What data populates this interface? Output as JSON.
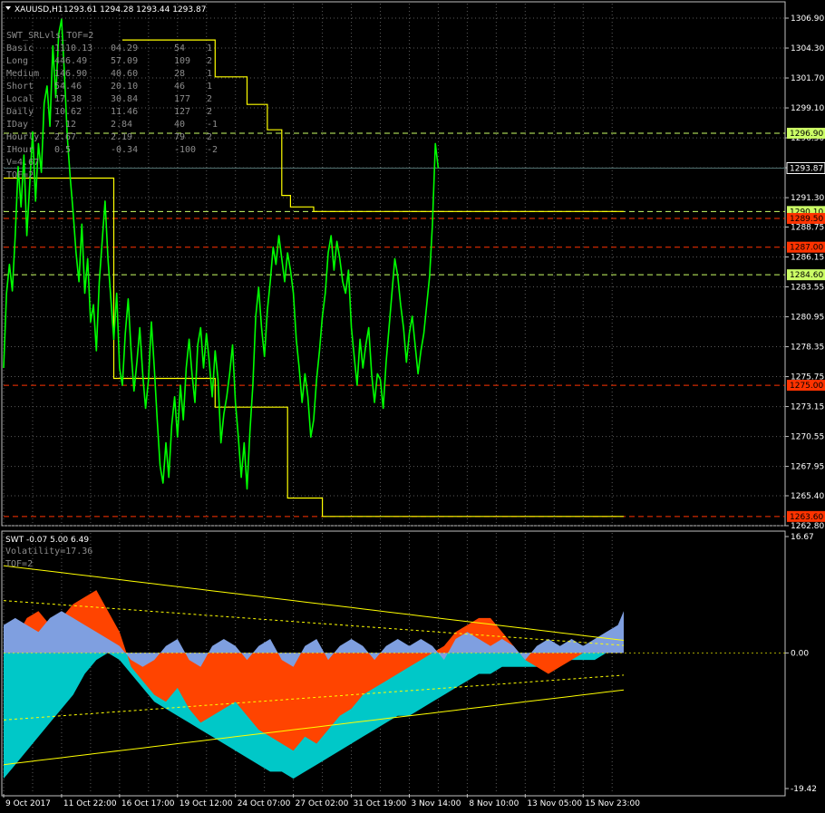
{
  "colors": {
    "background": "#000000",
    "grid": "#5a5a5a",
    "price_line": "#00ff00",
    "level_line": "#ffff00",
    "resistance_red": "#ff3300",
    "support_green_label": "#ccff66",
    "current_price_label": "#000000",
    "area_orange": "#ff4400",
    "area_blue": "#7f9fe0",
    "area_cyan": "#00c8c8",
    "text": "#ffffff",
    "indicator_text": "#8c8c8c"
  },
  "main_header": {
    "symbol": "XAUUSD,H1",
    "ohlc": "1293.61 1294.28 1293.44 1293.87"
  },
  "indicator_table": {
    "title": "SWT_SRLvls_TOF=2",
    "rows": [
      {
        "name": "Basic",
        "v1": "1110.13",
        "v2": "04.29",
        "v3": "54",
        "v4": "1"
      },
      {
        "name": "Long",
        "v1": "446.49",
        "v2": "57.09",
        "v3": "109",
        "v4": "2"
      },
      {
        "name": "Medium",
        "v1": "146.90",
        "v2": "40.60",
        "v3": "28",
        "v4": "1"
      },
      {
        "name": "Short",
        "v1": "54.46",
        "v2": "20.10",
        "v3": "46",
        "v4": "1"
      },
      {
        "name": "Local",
        "v1": "17.38",
        "v2": "30.84",
        "v3": "177",
        "v4": "2"
      },
      {
        "name": "Daily",
        "v1": "10.62",
        "v2": "11.46",
        "v3": "127",
        "v4": "2"
      },
      {
        "name": "IDay",
        "v1": "7.12",
        "v2": "2.84",
        "v3": "40",
        "v4": "-1"
      },
      {
        "name": "Hourly",
        "v1": "2.67",
        "v2": "2.19",
        "v3": "79",
        "v4": "2"
      },
      {
        "name": "IHour",
        "v1": "0.5",
        "v2": "-0.34",
        "v3": "-100",
        "v4": "-2"
      }
    ],
    "footer": [
      "V=4.67",
      "TOF=2"
    ]
  },
  "sub_header": {
    "title": "SWT -0.07 5.00 6.49",
    "lines": [
      "Volatility=17.36",
      "TOF=2"
    ]
  },
  "chart_data": {
    "type": "line",
    "price_axis": {
      "ticks": [
        "1306.90",
        "1304.30",
        "1301.70",
        "1299.10",
        "1296.50",
        "1293.90",
        "1291.30",
        "1288.75",
        "1286.15",
        "1283.55",
        "1280.95",
        "1278.35",
        "1275.75",
        "1273.15",
        "1270.55",
        "1267.95",
        "1265.40",
        "1262.80"
      ],
      "ylim": [
        1262.8,
        1306.9
      ]
    },
    "sub_axis": {
      "ticks": [
        "16.67",
        "0.00",
        "-19.42"
      ],
      "ylim": [
        -19.42,
        16.67
      ]
    },
    "x_ticks": [
      "9 Oct 2017",
      "11 Oct 22:00",
      "16 Oct 17:00",
      "19 Oct 12:00",
      "24 Oct 07:00",
      "27 Oct 02:00",
      "31 Oct 19:00",
      "3 Nov 14:00",
      "8 Nov 10:00",
      "13 Nov 05:00",
      "15 Nov 23:00"
    ],
    "x_tick_positions": [
      0,
      1,
      2,
      3,
      4,
      5,
      6,
      7,
      8,
      9,
      10
    ],
    "price_series": {
      "x": [
        0,
        0.05,
        0.1,
        0.15,
        0.2,
        0.25,
        0.3,
        0.35,
        0.4,
        0.45,
        0.5,
        0.55,
        0.6,
        0.65,
        0.7,
        0.75,
        0.8,
        0.85,
        0.9,
        0.95,
        1.0,
        1.05,
        1.1,
        1.15,
        1.2,
        1.25,
        1.3,
        1.35,
        1.4,
        1.45,
        1.5,
        1.55,
        1.6,
        1.65,
        1.7,
        1.75,
        1.8,
        1.85,
        1.9,
        1.95,
        2.0,
        2.05,
        2.1,
        2.15,
        2.2,
        2.25,
        2.3,
        2.35,
        2.4,
        2.45,
        2.5,
        2.55,
        2.6,
        2.65,
        2.7,
        2.75,
        2.8,
        2.85,
        2.9,
        2.95,
        3.0,
        3.05,
        3.1,
        3.15,
        3.2,
        3.25,
        3.3,
        3.35,
        3.4,
        3.45,
        3.5,
        3.55,
        3.6,
        3.65,
        3.7,
        3.75,
        3.8,
        3.85,
        3.9,
        3.95,
        4.0,
        4.05,
        4.1,
        4.15,
        4.2,
        4.25,
        4.3,
        4.35,
        4.4,
        4.45,
        4.5,
        4.55,
        4.6,
        4.65,
        4.7,
        4.75,
        4.8,
        4.85,
        4.9,
        4.95,
        5.0,
        5.05,
        5.1,
        5.15,
        5.2,
        5.25,
        5.3,
        5.35,
        5.4,
        5.45,
        5.5,
        5.55,
        5.6,
        5.65,
        5.7,
        5.75,
        5.8,
        5.85,
        5.9,
        5.95,
        6.0,
        6.05,
        6.1,
        6.15,
        6.2,
        6.25,
        6.3,
        6.35,
        6.4,
        6.45,
        6.5,
        6.55,
        6.6,
        6.65,
        6.7,
        6.75,
        6.8,
        6.85,
        6.9,
        6.95,
        7.0,
        7.05,
        7.1,
        7.15,
        7.2,
        7.25,
        7.3,
        7.35,
        7.4,
        7.45,
        7.5,
        7.55,
        7.6,
        7.65,
        7.7,
        7.75,
        7.8,
        7.85,
        7.9,
        7.95,
        8.0,
        8.05,
        8.1,
        8.15,
        8.2,
        8.25,
        8.3,
        8.35,
        8.4,
        8.45,
        8.5,
        8.55,
        8.6,
        8.65,
        8.7,
        8.75,
        8.8,
        8.85,
        8.9,
        8.95,
        9.0,
        9.05,
        9.1,
        9.15,
        9.2,
        9.25,
        9.3,
        9.35,
        9.4,
        9.45,
        9.5,
        9.55,
        9.6,
        9.65,
        9.7,
        9.75,
        9.8,
        9.85,
        9.9,
        9.95,
        10.0,
        10.05,
        10.1,
        10.15,
        10.2,
        10.25,
        10.3,
        10.35,
        10.4,
        10.45,
        10.5,
        10.55,
        10.6,
        10.65,
        10.7
      ],
      "y": [
        1276.5,
        1283.0,
        1285.5,
        1283.2,
        1288.0,
        1294.0,
        1290.5,
        1295.0,
        1288.0,
        1292.5,
        1297.0,
        1291.0,
        1296.0,
        1293.5,
        1299.5,
        1301.0,
        1297.5,
        1304.5,
        1300.0,
        1305.5,
        1306.8,
        1302.0,
        1296.5,
        1293.0,
        1290.0,
        1286.5,
        1284.0,
        1289.0,
        1283.0,
        1286.0,
        1280.5,
        1282.0,
        1278.0,
        1284.0,
        1287.5,
        1291.0,
        1286.0,
        1282.5,
        1279.0,
        1283.0,
        1276.5,
        1275.0,
        1279.5,
        1282.5,
        1278.0,
        1274.5,
        1277.0,
        1280.0,
        1276.0,
        1273.0,
        1275.5,
        1280.5,
        1276.5,
        1272.0,
        1268.0,
        1266.5,
        1270.0,
        1267.0,
        1271.5,
        1274.0,
        1270.5,
        1275.0,
        1272.0,
        1276.5,
        1279.0,
        1276.0,
        1273.5,
        1278.5,
        1280.0,
        1276.5,
        1279.5,
        1277.0,
        1274.0,
        1278.0,
        1275.5,
        1270.0,
        1272.5,
        1274.0,
        1276.0,
        1278.5,
        1273.5,
        1270.5,
        1267.0,
        1270.0,
        1266.0,
        1271.0,
        1275.0,
        1281.0,
        1283.5,
        1280.0,
        1277.5,
        1281.5,
        1284.0,
        1287.0,
        1285.5,
        1288.0,
        1286.0,
        1284.0,
        1286.5,
        1285.0,
        1283.0,
        1279.0,
        1276.5,
        1273.5,
        1276.0,
        1274.0,
        1270.5,
        1272.0,
        1275.5,
        1278.0,
        1281.0,
        1283.0,
        1286.5,
        1288.0,
        1285.0,
        1287.5,
        1286.0,
        1284.0,
        1283.0,
        1285.0,
        1280.0,
        1277.5,
        1275.0,
        1279.0,
        1276.5,
        1278.5,
        1280.0,
        1276.0,
        1273.5,
        1276.0,
        1275.5,
        1273.0,
        1277.0,
        1280.0,
        1283.0,
        1286.0,
        1284.5,
        1282.0,
        1280.0,
        1277.0,
        1279.5,
        1281.0,
        1278.5,
        1276.0,
        1278.0,
        1279.5,
        1282.0,
        1284.5,
        1289.0,
        1296.0,
        1293.87
      ]
    },
    "levels": {
      "support_resistance_labels": [
        {
          "value": "1296.90",
          "color": "#ccff66"
        },
        {
          "value": "1293.87",
          "color": "#000000"
        },
        {
          "value": "1290.10",
          "color": "#ccff66"
        },
        {
          "value": "1289.50",
          "color": "#ff3300"
        },
        {
          "value": "1287.00",
          "color": "#ff3300"
        },
        {
          "value": "1284.60",
          "color": "#ccff66"
        },
        {
          "value": "1275.00",
          "color": "#ff3300"
        },
        {
          "value": "1263.60",
          "color": "#ff3300"
        }
      ],
      "step_lines": [
        {
          "x": [
            0,
            1.9,
            1.9,
            3.65,
            3.65,
            4.9,
            4.9,
            5.5,
            5.5,
            10.7
          ],
          "y": [
            1293.0,
            1293.0,
            1275.6,
            1275.6,
            1273.1,
            1273.1,
            1265.2,
            1265.2,
            1263.6,
            1263.6
          ]
        },
        {
          "x": [
            2.05,
            3.65,
            3.65,
            4.2,
            4.2,
            4.55,
            4.55,
            4.8,
            4.8,
            4.95,
            4.95,
            5.35,
            5.35,
            10.7
          ],
          "y": [
            1305.0,
            1305.0,
            1301.8,
            1301.8,
            1299.4,
            1299.4,
            1297.2,
            1297.2,
            1291.5,
            1291.5,
            1290.5,
            1290.5,
            1290.1,
            1290.1
          ]
        }
      ]
    },
    "oscillator": {
      "x": [
        0,
        0.2,
        0.4,
        0.6,
        0.8,
        1.0,
        1.2,
        1.4,
        1.6,
        1.8,
        2.0,
        2.2,
        2.4,
        2.6,
        2.8,
        3.0,
        3.2,
        3.4,
        3.6,
        3.8,
        4.0,
        4.2,
        4.4,
        4.6,
        4.8,
        5.0,
        5.2,
        5.4,
        5.6,
        5.8,
        6.0,
        6.2,
        6.4,
        6.6,
        6.8,
        7.0,
        7.2,
        7.4,
        7.6,
        7.8,
        8.0,
        8.2,
        8.4,
        8.6,
        8.8,
        9.0,
        9.2,
        9.4,
        9.6,
        9.8,
        10.0,
        10.2,
        10.4,
        10.6,
        10.7
      ],
      "orange": [
        3,
        2,
        5,
        6,
        4,
        5,
        7,
        8,
        9,
        6,
        3,
        -2,
        -4,
        -6,
        -7,
        -5,
        -8,
        -10,
        -9,
        -8,
        -7,
        -9,
        -11,
        -12,
        -13,
        -14,
        -12,
        -13,
        -11,
        -9,
        -8,
        -6,
        -5,
        -4,
        -3,
        -2,
        -1,
        0,
        1,
        3,
        4,
        5,
        5,
        3,
        1,
        -1,
        -2,
        -3,
        -2,
        -1,
        0,
        1,
        1,
        2,
        4
      ],
      "blue": [
        4,
        5,
        4,
        3,
        5,
        6,
        5,
        4,
        3,
        2,
        1,
        -1,
        -2,
        -1,
        1,
        2,
        -1,
        -2,
        1,
        2,
        1,
        -1,
        1,
        2,
        -1,
        -2,
        1,
        2,
        -1,
        1,
        2,
        1,
        -1,
        1,
        2,
        1,
        2,
        1,
        -1,
        2,
        3,
        2,
        1,
        2,
        1,
        -1,
        1,
        2,
        1,
        2,
        1,
        2,
        3,
        4,
        6
      ],
      "cyan": [
        -18,
        -16,
        -14,
        -12,
        -10,
        -8,
        -6,
        -3,
        -1,
        0,
        -1,
        -3,
        -5,
        -7,
        -8,
        -9,
        -10,
        -11,
        -12,
        -13,
        -14,
        -15,
        -16,
        -17,
        -17,
        -18,
        -17,
        -16,
        -15,
        -14,
        -13,
        -12,
        -11,
        -10,
        -9,
        -9,
        -8,
        -7,
        -6,
        -5,
        -4,
        -3,
        -3,
        -2,
        -2,
        -2,
        -2,
        -1,
        -1,
        -1,
        -1,
        -1,
        0,
        0,
        0
      ],
      "band_upper": [
        12.5,
        12.3,
        12.1,
        11.9,
        11.7,
        11.5,
        11.3,
        11.1,
        10.9,
        10.7,
        10.5,
        10.3,
        10.1,
        9.9,
        9.7,
        9.5,
        9.3,
        9.1,
        8.9,
        8.7,
        8.5,
        8.3,
        8.1,
        7.9,
        7.7,
        7.5,
        7.3,
        7.1,
        6.9,
        6.7,
        6.5,
        6.3,
        6.1,
        5.9,
        5.7,
        5.5,
        5.3,
        5.1,
        4.9,
        4.7,
        4.5,
        4.3,
        4.1,
        3.9,
        3.7,
        3.5,
        3.3,
        3.1,
        2.9,
        2.7,
        2.5,
        2.3,
        2.1,
        1.9,
        1.8
      ],
      "band_lower": [
        -16.0,
        -15.8,
        -15.6,
        -15.4,
        -15.2,
        -15.0,
        -14.8,
        -14.6,
        -14.4,
        -14.2,
        -14.0,
        -13.8,
        -13.6,
        -13.4,
        -13.2,
        -13.0,
        -12.8,
        -12.6,
        -12.4,
        -12.2,
        -12.0,
        -11.8,
        -11.6,
        -11.4,
        -11.2,
        -11.0,
        -10.8,
        -10.6,
        -10.4,
        -10.2,
        -10.0,
        -9.8,
        -9.6,
        -9.4,
        -9.2,
        -9.0,
        -8.8,
        -8.6,
        -8.4,
        -8.2,
        -8.0,
        -7.8,
        -7.6,
        -7.4,
        -7.2,
        -7.0,
        -6.8,
        -6.6,
        -6.4,
        -6.2,
        -6.0,
        -5.8,
        -5.6,
        -5.4,
        -5.3
      ]
    }
  }
}
